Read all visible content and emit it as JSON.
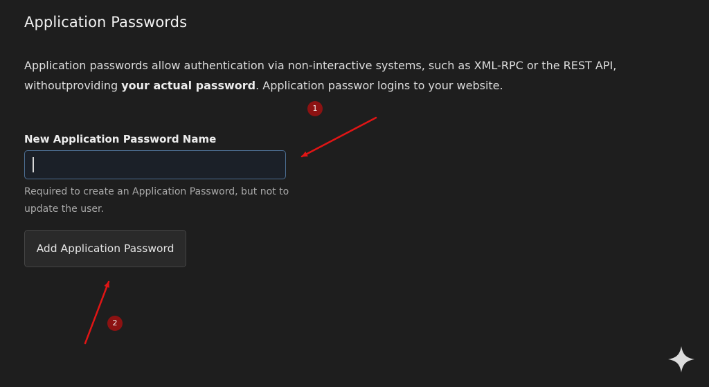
{
  "section": {
    "title": "Application Passwords",
    "description_part1": "Application passwords allow authentication via non-interactive systems, such as XML-RPC or the REST API, withoutproviding ",
    "description_emphasis": "your actual password",
    "description_part2": ". Application passwor logins to your website."
  },
  "form": {
    "field_label": "New Application Password Name",
    "input_value": "",
    "help_text": "Required to create an Application Password, but not to update the user.",
    "submit_label": "Add Application Password"
  },
  "annotations": {
    "badge_1": "1",
    "badge_2": "2",
    "arrow_color": "#e01515",
    "badge_color": "#8c1212"
  },
  "icons": {
    "watermark": "sparkle-icon"
  },
  "colors": {
    "background": "#1e1e1e",
    "input_border": "#4d6f94",
    "button_background": "#2a2a2a"
  }
}
